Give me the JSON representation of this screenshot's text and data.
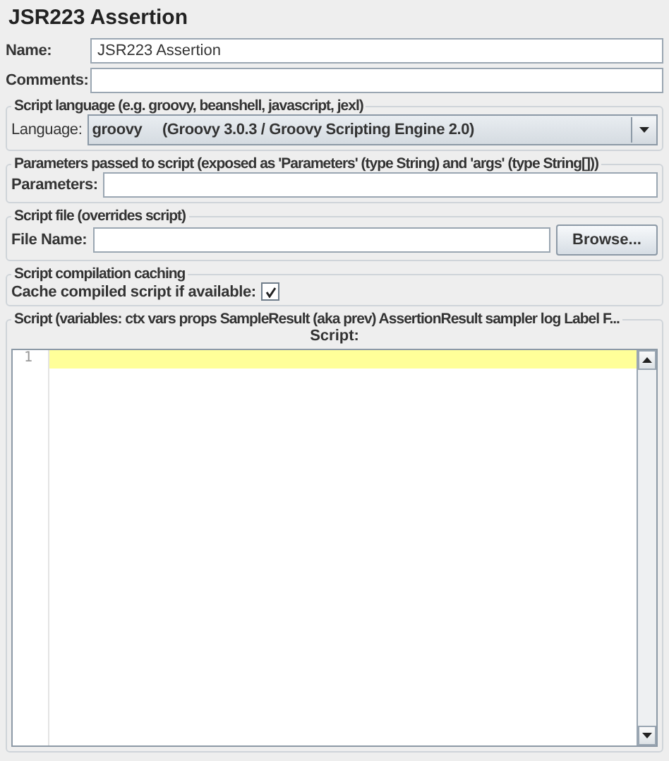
{
  "title": "JSR223 Assertion",
  "name_field": {
    "label": "Name:",
    "value": "JSR223 Assertion"
  },
  "comments_field": {
    "label": "Comments:"
  },
  "script_language": {
    "legend": "Script language (e.g. groovy, beanshell, javascript, jexl)",
    "label": "Language:",
    "value": "groovy     (Groovy 3.0.3 / Groovy Scripting Engine 2.0)"
  },
  "parameters": {
    "legend": "Parameters passed to script (exposed as 'Parameters' (type String) and 'args' (type String[]))",
    "label": "Parameters:"
  },
  "script_file": {
    "legend": "Script file (overrides script)",
    "label": "File Name:",
    "button": "Browse..."
  },
  "caching": {
    "legend": "Script compilation caching",
    "label": "Cache compiled script if available:",
    "checked": true
  },
  "script": {
    "legend": "Script (variables: ctx vars props SampleResult (aka prev) AssertionResult sampler log Label F...",
    "editor_label": "Script:",
    "line_numbers": [
      "1"
    ]
  }
}
